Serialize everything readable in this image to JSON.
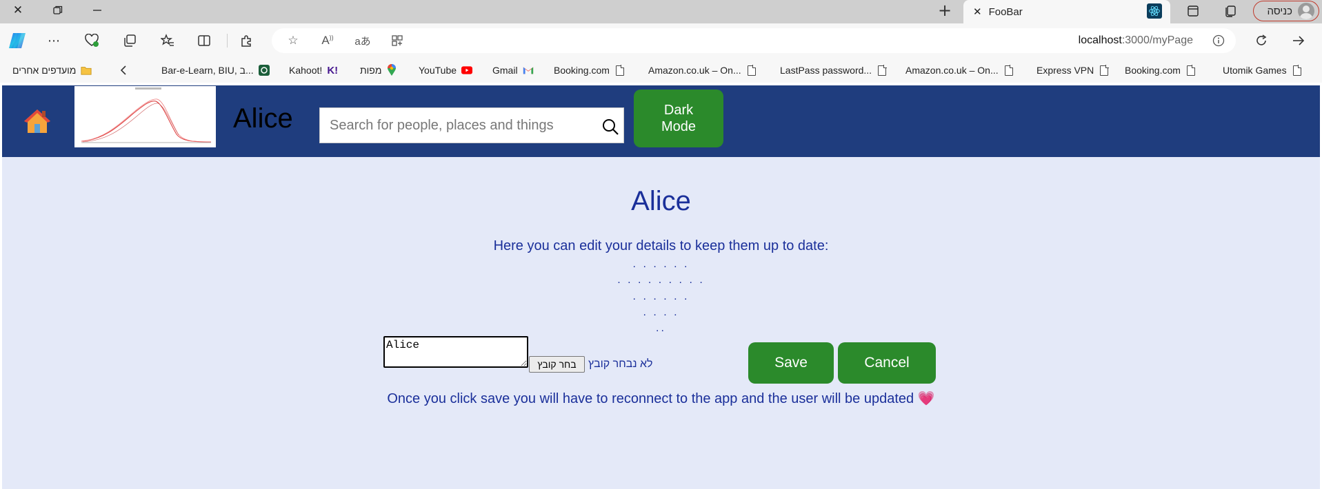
{
  "browser": {
    "tab": {
      "title": "FooBar"
    },
    "profile_label": "כניסה",
    "address": {
      "host": "localhost",
      "path": ":3000/myPage"
    },
    "bookmarks": {
      "other_favorites": "מועדפים אחרים",
      "items": [
        "Bar-e-Learn, BIU, ב...",
        "Kahoot!",
        "מפות",
        "YouTube",
        "Gmail",
        "Booking.com",
        "Amazon.co.uk – On...",
        "LastPass password...",
        "Amazon.co.uk – On...",
        "Express VPN",
        "Booking.com",
        "Utomik Games"
      ]
    }
  },
  "navbar": {
    "brand": "Alice",
    "search_placeholder": "Search for people, places and things",
    "dark_mode_label": "Dark Mode"
  },
  "main": {
    "title": "Alice",
    "subtitle": "Here you can edit your details to keep them up to date:",
    "dots": [
      ". . . . . .",
      ". . . . . . . . .",
      ". . . . . .",
      ". . . .",
      ".."
    ],
    "name_value": "Alice",
    "file_button": "בחר קובץ",
    "file_status": "לא נבחר קובץ",
    "save_label": "Save",
    "cancel_label": "Cancel",
    "note": "Once you click save you will have to reconnect to the app and the user will be updated",
    "note_emoji": "💗"
  },
  "colors": {
    "navbar": "#1f3d7e",
    "page_bg": "#e4e9f8",
    "button_green": "#2b8a2b",
    "text_blue": "#1a2f9a"
  }
}
